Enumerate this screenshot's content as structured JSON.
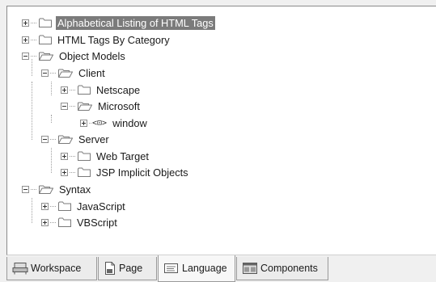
{
  "tree": {
    "nodes": [
      {
        "label": "Alphabetical Listing of HTML Tags",
        "icon": "folder-closed-icon",
        "toggle": "plus",
        "selected": true
      },
      {
        "label": "HTML Tags By Category",
        "icon": "folder-closed-icon",
        "toggle": "plus",
        "selected": false
      },
      {
        "label": "Object Models",
        "icon": "folder-open-icon",
        "toggle": "minus",
        "selected": false
      },
      {
        "label": "Client",
        "icon": "folder-open-icon",
        "toggle": "minus",
        "selected": false
      },
      {
        "label": "Netscape",
        "icon": "folder-closed-icon",
        "toggle": "plus",
        "selected": false
      },
      {
        "label": "Microsoft",
        "icon": "folder-open-icon",
        "toggle": "minus",
        "selected": false
      },
      {
        "label": "window",
        "icon": "tag-icon",
        "icon_glyph": "<⊡>",
        "toggle": "plus",
        "selected": false
      },
      {
        "label": "Server",
        "icon": "folder-open-icon",
        "toggle": "minus",
        "selected": false
      },
      {
        "label": "Web Target",
        "icon": "folder-closed-icon",
        "toggle": "plus",
        "selected": false
      },
      {
        "label": "JSP Implicit Objects",
        "icon": "folder-closed-icon",
        "toggle": "plus",
        "selected": false
      },
      {
        "label": "Syntax",
        "icon": "folder-open-icon",
        "toggle": "minus",
        "selected": false
      },
      {
        "label": "JavaScript",
        "icon": "folder-closed-icon",
        "toggle": "plus",
        "selected": false
      },
      {
        "label": "VBScript",
        "icon": "folder-closed-icon",
        "toggle": "plus",
        "selected": false
      }
    ]
  },
  "tabs": [
    {
      "label": "Workspace",
      "icon": "workspace-icon",
      "active": false
    },
    {
      "label": "Page",
      "icon": "page-icon",
      "active": false
    },
    {
      "label": "Language",
      "icon": "language-icon",
      "active": true
    },
    {
      "label": "Components",
      "icon": "components-icon",
      "active": false
    }
  ],
  "colors": {
    "selection_background": "#7b7b7b",
    "panel_background": "#ffffff",
    "window_background": "#f0f0f0"
  }
}
